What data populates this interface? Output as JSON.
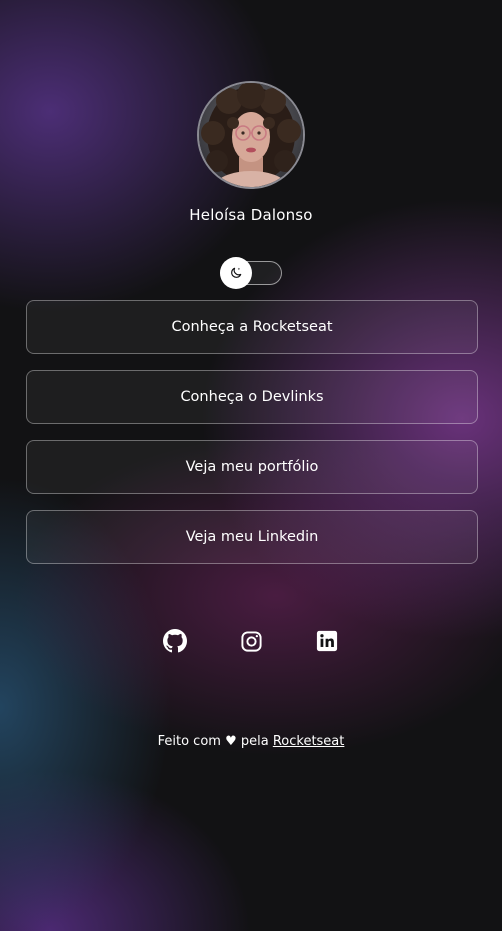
{
  "profile": {
    "name": "Heloísa Dalonso",
    "avatar_alt": "Heloísa Dalonso",
    "avatar_icon": "profile-photo"
  },
  "theme_switch": {
    "icon": "moon-icon",
    "state": "dark"
  },
  "links": [
    {
      "label": "Conheça a Rocketseat"
    },
    {
      "label": "Conheça o Devlinks"
    },
    {
      "label": "Veja meu portfólio"
    },
    {
      "label": "Veja meu Linkedin"
    }
  ],
  "social": [
    {
      "icon": "github-icon"
    },
    {
      "icon": "instagram-icon"
    },
    {
      "icon": "linkedin-icon"
    }
  ],
  "footer": {
    "prefix": "Feito com ♥ pela ",
    "link_label": "Rocketseat"
  },
  "colors": {
    "background": "#121214",
    "text": "#ffffff",
    "purple_glow": "#6e3b8c",
    "teal_glow": "#285578"
  }
}
